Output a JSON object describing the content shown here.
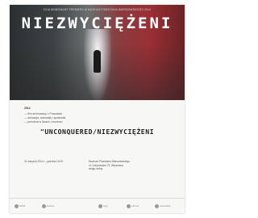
{
  "poster": {
    "topline": "FILM ANIMOWANY PREMIERA W MUZEUM POWSTANIA WARSZAWSKIEGO 2014",
    "title": "NIEZWYCIĘŻENI",
    "info_heading": "2014",
    "info_lines": [
      "— film animowany o Powstaniu",
      "— animacja, warsztaty i spotkania",
      "— premiera w kinach i muzeum"
    ],
    "subtitle": "\"UNCONQUERED/NIEZWYCIĘŻENI",
    "date_text": "31 sierpnia 2014 r., godzina 19.00",
    "venue_lines": [
      "Muzeum Powstania Warszawskiego",
      "ul. Grzybowska 79, Warszawa",
      "wstęp wolny"
    ],
    "footer_logos": [
      "MPW",
      "kultura",
      "logo",
      "partner",
      "warszawa"
    ]
  }
}
